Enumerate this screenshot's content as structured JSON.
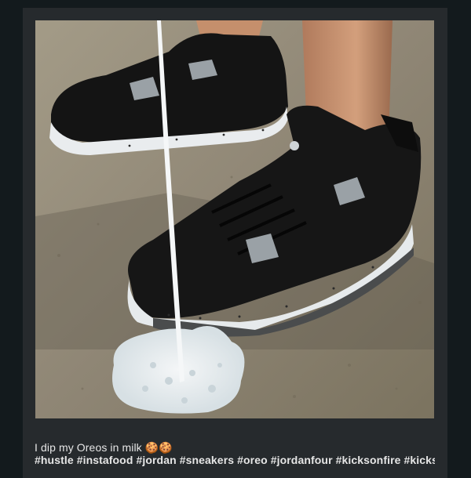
{
  "post": {
    "image_alt": "Black and white speckled sneakers on sand with milk being poured",
    "caption_text": "I dip my Oreos in milk",
    "caption_emoji": "🍪🍪",
    "caption_tags": "#hustle #instafood #jordan #sneakers #oreo #jordanfour #kicksonfire #kicksfeed"
  },
  "colors": {
    "page_bg": "#131a1d",
    "card_bg": "#262a2d",
    "caption_text": "#e6e6e6"
  }
}
